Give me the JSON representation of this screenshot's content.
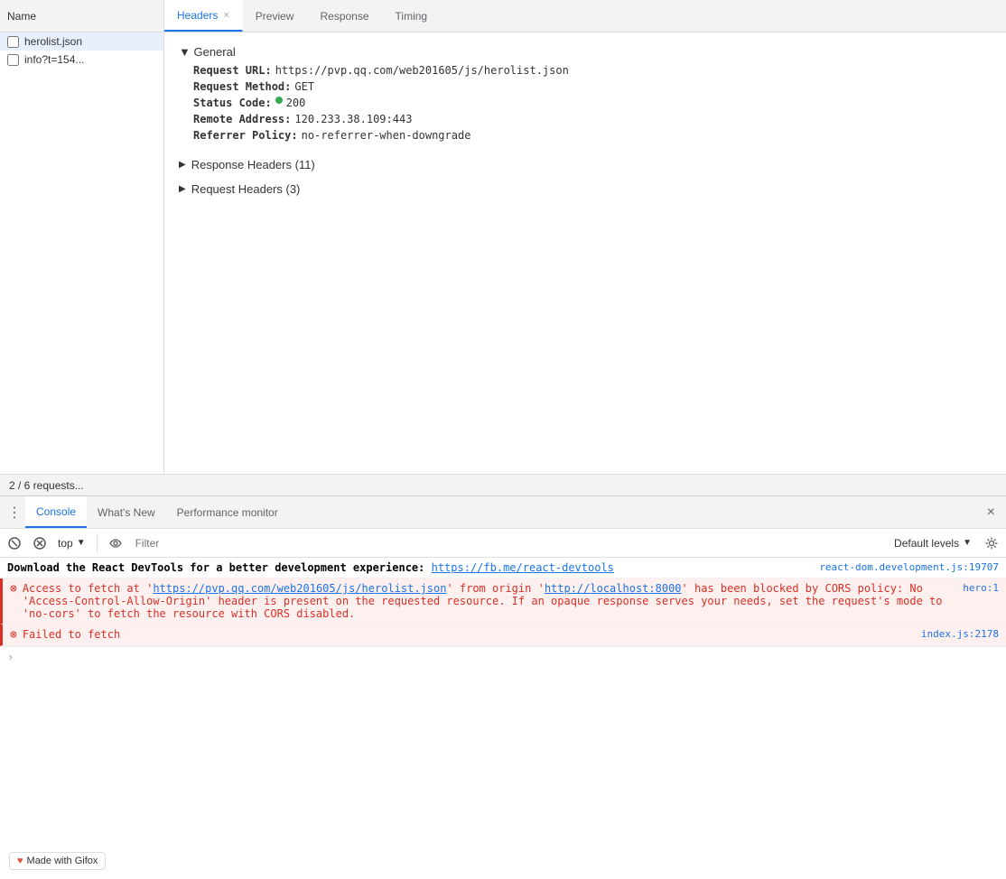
{
  "tabs": {
    "name_col": "Name",
    "items": [
      {
        "label": "Headers",
        "active": true,
        "closeable": true,
        "close": "×"
      },
      {
        "label": "Preview",
        "active": false
      },
      {
        "label": "Response",
        "active": false
      },
      {
        "label": "Timing",
        "active": false
      }
    ]
  },
  "file_list": {
    "items": [
      {
        "name": "herolist.json",
        "checked": false,
        "active": true
      },
      {
        "name": "info?t=154...",
        "checked": false,
        "active": false
      }
    ]
  },
  "headers_panel": {
    "general_section": {
      "title": "▼ General",
      "fields": [
        {
          "label": "Request URL:",
          "value": "https://pvp.qq.com/web201605/js/herolist.json"
        },
        {
          "label": "Request Method:",
          "value": "GET"
        },
        {
          "label": "Status Code:",
          "value": "200",
          "has_dot": true
        },
        {
          "label": "Remote Address:",
          "value": "120.233.38.109:443"
        },
        {
          "label": "Referrer Policy:",
          "value": "no-referrer-when-downgrade"
        }
      ]
    },
    "response_headers": {
      "title": "Response Headers (11)",
      "collapsed": true
    },
    "request_headers": {
      "title": "Request Headers (3)",
      "collapsed": true
    }
  },
  "status_bar": {
    "text": "2 / 6 requests..."
  },
  "console": {
    "tabs": [
      {
        "label": "Console",
        "active": true
      },
      {
        "label": "What's New",
        "active": false
      },
      {
        "label": "Performance monitor",
        "active": false
      }
    ],
    "toolbar": {
      "context": "top",
      "filter_placeholder": "Filter",
      "levels": "Default levels"
    },
    "messages": [
      {
        "type": "info",
        "source": "react-dom.development.js:19707",
        "text_bold": "Download the React DevTools for a better development experience:",
        "link": "https://fb.me/react-devtools",
        "link_display": "http\ns://fb.me/react-devtools"
      },
      {
        "type": "error",
        "source": "hero:1",
        "has_icon": true,
        "text": "Access to fetch at 'https://pvp.qq.com/web201605/js/herolist.json' from origin 'http://localhost:8000' has been blocked by CORS policy: No 'Access-Control-Allow-Origin' header is present on the requested resource. If an opaque response serves your needs, set the request's mode to 'no-cors' to fetch the resource with CORS disabled.",
        "url1": "https://pvp.qq.com/web201605/js/herolist.json",
        "url2": "http://localhost:8000"
      },
      {
        "type": "error",
        "source": "index.js:2178",
        "has_icon": true,
        "text": "Failed to fetch"
      }
    ],
    "prompt": ""
  },
  "gifox": {
    "label": "Made with Gifox"
  }
}
